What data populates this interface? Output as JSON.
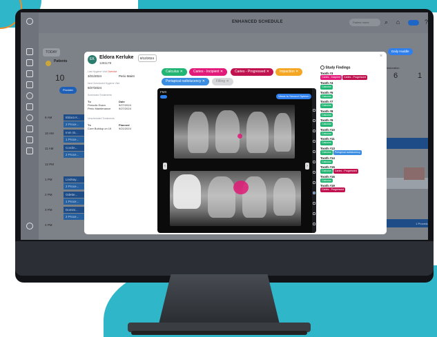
{
  "app": {
    "title": "ENHANCED SCHEDULE",
    "search_placeholder": "Patient name"
  },
  "schedule": {
    "today_label": "TODAY",
    "patients_label": "Patients",
    "patients_count": "10",
    "provider_label": "Provider",
    "restoration_label": "Restoration",
    "replacement_label": "Restoration Replacement",
    "restoration_count": "6",
    "replacement_count": "1",
    "extra_count": "1",
    "daily_huddle": "Daily Huddle",
    "times": [
      "9 AM",
      "10 AM",
      "11 AM",
      "12 PM",
      "1 PM",
      "2 PM",
      "3 PM",
      "4 PM"
    ],
    "rows": [
      {
        "time": "9a",
        "name": "Eldora K..."
      },
      {
        "time": "",
        "name": "2 Proce..."
      },
      {
        "time": "10a",
        "name": "Irvin St..."
      },
      {
        "time": "",
        "name": "1 Proce..."
      },
      {
        "time": "11a",
        "name": "CordiA..."
      },
      {
        "time": "",
        "name": "2 Proce..."
      },
      {
        "time": "1p",
        "name": "Lindsay..."
      },
      {
        "time": "",
        "name": "2 Proce..."
      },
      {
        "time": "2p",
        "name": "Odette..."
      },
      {
        "time": "",
        "name": "1 Proce..."
      },
      {
        "time": "3p",
        "name": "Domini..."
      },
      {
        "time": "",
        "name": "2 Proce..."
      }
    ],
    "right_procedure": "1 Procedure"
  },
  "modal": {
    "patient_initials": "EK",
    "patient_name": "Eldora Kerluke",
    "patient_id": "1281178",
    "date_selected": "8/12/2024",
    "last_hygiene_label": "Last Hygiene Visit",
    "last_hygiene_tag": "Overdue",
    "last_hygiene_date": "3/21/2024",
    "last_hygiene_type": "Perio Maint",
    "next_visit_label": "Next Scheduled Hygiene Visit",
    "next_visit_date": "9/27/2024",
    "scheduled_label": "Scheduled Treatments",
    "tx_header": "Tx",
    "date_header": "Date",
    "scheduled": [
      {
        "tx": "Periodic Exam",
        "date": "9/27/2024"
      },
      {
        "tx": "Perio Maintenance",
        "date": "9/27/2024"
      }
    ],
    "unscheduled_label": "Unscheduled Treatments",
    "planned_header": "Planned",
    "unscheduled": [
      {
        "tx": "Core Buildup on 19",
        "date": "9/21/2024"
      }
    ],
    "chips": [
      {
        "label": "Calculus ✕",
        "color": "#22b573"
      },
      {
        "label": "Caries - Incipient ✕",
        "color": "#e21a7a"
      },
      {
        "label": "Caries - Progressed ✕",
        "color": "#c0124e"
      },
      {
        "label": "Impaction ✕",
        "color": "#f5a623"
      },
      {
        "label": "Periapical radiolucency ✕",
        "color": "#3a8de0"
      },
      {
        "label": "Filling ✕",
        "color": "#d6d8db"
      }
    ],
    "fmx_label": "FMX",
    "second_opinion": "Views to Second Opinion",
    "findings_title": "Study Findings",
    "findings": [
      {
        "tooth": "Tooth #3",
        "tags": [
          {
            "t": "Caries - Incipient",
            "c": "#e21a7a"
          },
          {
            "t": "Caries - Progressed",
            "c": "#c0124e"
          }
        ]
      },
      {
        "tooth": "Tooth #4",
        "tags": [
          {
            "t": "Calculus",
            "c": "#22b573"
          }
        ]
      },
      {
        "tooth": "Tooth #5",
        "tags": [
          {
            "t": "Calculus",
            "c": "#22b573"
          }
        ]
      },
      {
        "tooth": "Tooth #7",
        "tags": [
          {
            "t": "Calculus",
            "c": "#22b573"
          }
        ]
      },
      {
        "tooth": "Tooth #8",
        "tags": [
          {
            "t": "Calculus",
            "c": "#22b573"
          }
        ]
      },
      {
        "tooth": "Tooth #9",
        "tags": [
          {
            "t": "Calculus",
            "c": "#22b573"
          }
        ]
      },
      {
        "tooth": "Tooth #10",
        "tags": [
          {
            "t": "Calculus",
            "c": "#22b573"
          }
        ]
      },
      {
        "tooth": "Tooth #11",
        "tags": [
          {
            "t": "Calculus",
            "c": "#22b573"
          }
        ]
      },
      {
        "tooth": "Tooth #13",
        "tags": [
          {
            "t": "Calculus",
            "c": "#22b573"
          },
          {
            "t": "Periapical radiolucency",
            "c": "#3a8de0"
          }
        ]
      },
      {
        "tooth": "Tooth #14",
        "tags": [
          {
            "t": "Calculus",
            "c": "#22b573"
          }
        ]
      },
      {
        "tooth": "Tooth #15",
        "tags": [
          {
            "t": "Calculus",
            "c": "#22b573"
          },
          {
            "t": "Caries - Progressed",
            "c": "#c0124e"
          }
        ]
      },
      {
        "tooth": "Tooth #16",
        "tags": [
          {
            "t": "Calculus",
            "c": "#22b573"
          }
        ]
      },
      {
        "tooth": "Tooth #19",
        "tags": [
          {
            "t": "Caries - Progressed",
            "c": "#c0124e"
          }
        ]
      }
    ]
  },
  "colors": {
    "accent": "#2f80ed",
    "brand_teal": "#2fb7c9",
    "calculus": "#22b573",
    "incipient": "#e21a7a"
  }
}
